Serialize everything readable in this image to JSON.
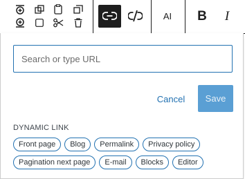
{
  "toolbar": {
    "ai_label": "AI",
    "bold_label": "B",
    "italic_label": "I"
  },
  "link_popover": {
    "url_placeholder": "Search or type URL",
    "cancel_label": "Cancel",
    "save_label": "Save",
    "dynamic_heading": "DYNAMIC LINK",
    "dynamic_links": [
      "Front page",
      "Blog",
      "Permalink",
      "Privacy policy",
      "Pagination next page",
      "E-mail",
      "Blocks",
      "Editor"
    ]
  },
  "colors": {
    "accent": "#2271b1",
    "save_disabled": "#5a9fd4",
    "toolbar_active": "#1e1e1e"
  }
}
